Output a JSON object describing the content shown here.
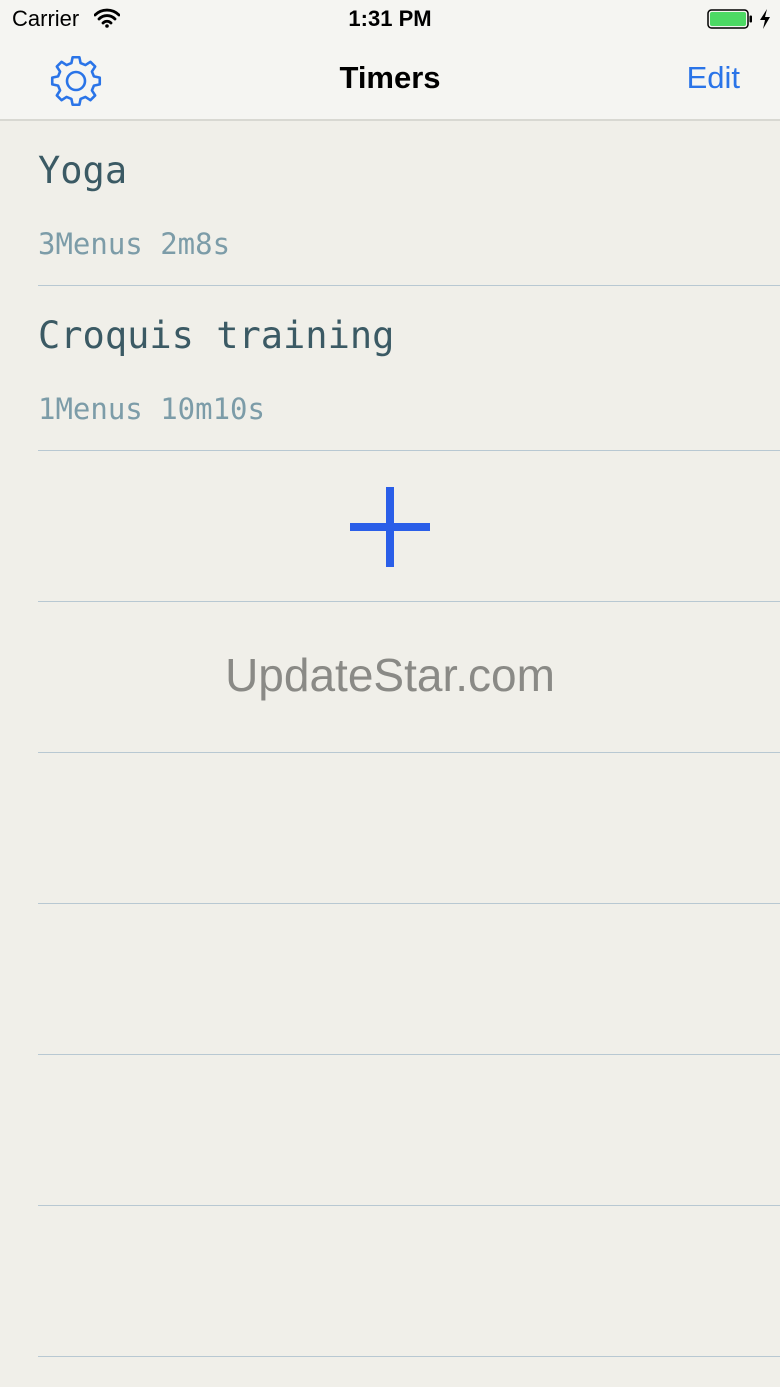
{
  "status_bar": {
    "carrier": "Carrier",
    "time": "1:31 PM",
    "battery_color": "#4cd964"
  },
  "nav": {
    "title": "Timers",
    "edit_label": "Edit",
    "settings_icon": "gear-icon",
    "accent_color": "#2a74e8"
  },
  "timers": [
    {
      "name": "Yoga",
      "detail": "3Menus 2m8s"
    },
    {
      "name": "Croquis training",
      "detail": "1Menus 10m10s"
    }
  ],
  "add_icon": "plus-icon",
  "watermark": "UpdateStar.com"
}
